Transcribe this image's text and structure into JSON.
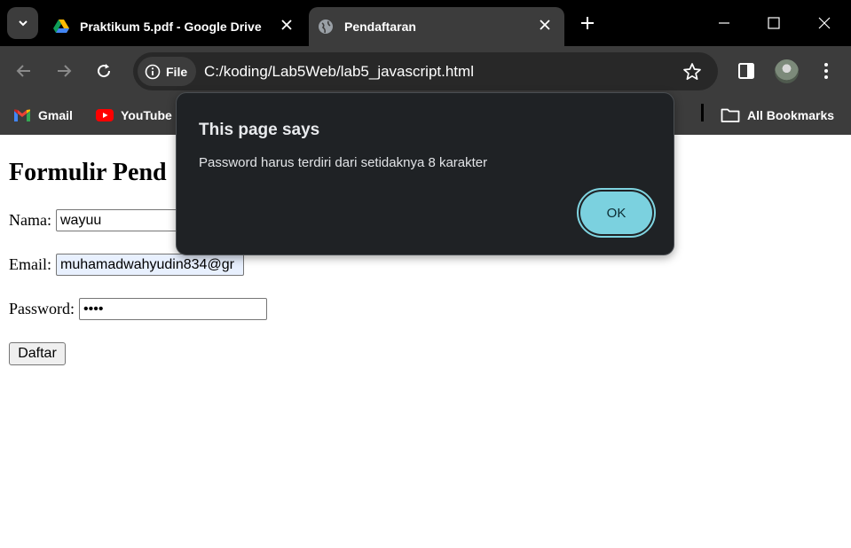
{
  "browser": {
    "tabs": [
      {
        "title": "Praktikum 5.pdf - Google Drive",
        "active": false,
        "favicon": "google-drive-icon"
      },
      {
        "title": "Pendaftaran",
        "active": true,
        "favicon": "globe-icon"
      }
    ],
    "address_bar": {
      "site_chip_label": "File",
      "url": "C:/koding/Lab5Web/lab5_javascript.html"
    },
    "bookmarks": [
      {
        "label": "Gmail",
        "icon": "gmail-icon"
      },
      {
        "label": "YouTube",
        "icon": "youtube-icon"
      }
    ],
    "all_bookmarks_label": "All Bookmarks"
  },
  "page": {
    "heading": "Formulir Pend",
    "fields": {
      "nama": {
        "label": "Nama:",
        "value": "wayuu"
      },
      "email": {
        "label": "Email:",
        "value": "muhamadwahyudin834@gr"
      },
      "password": {
        "label": "Password:",
        "value": "••••"
      }
    },
    "submit_label": "Daftar"
  },
  "dialog": {
    "title": "This page says",
    "message": "Password harus terdiri dari setidaknya 8 karakter",
    "ok_label": "OK"
  },
  "colors": {
    "titlebar": "#000000",
    "toolbar": "#3c3c3c",
    "dialog_bg": "#1f2225",
    "ok_button": "#7bd1df"
  }
}
